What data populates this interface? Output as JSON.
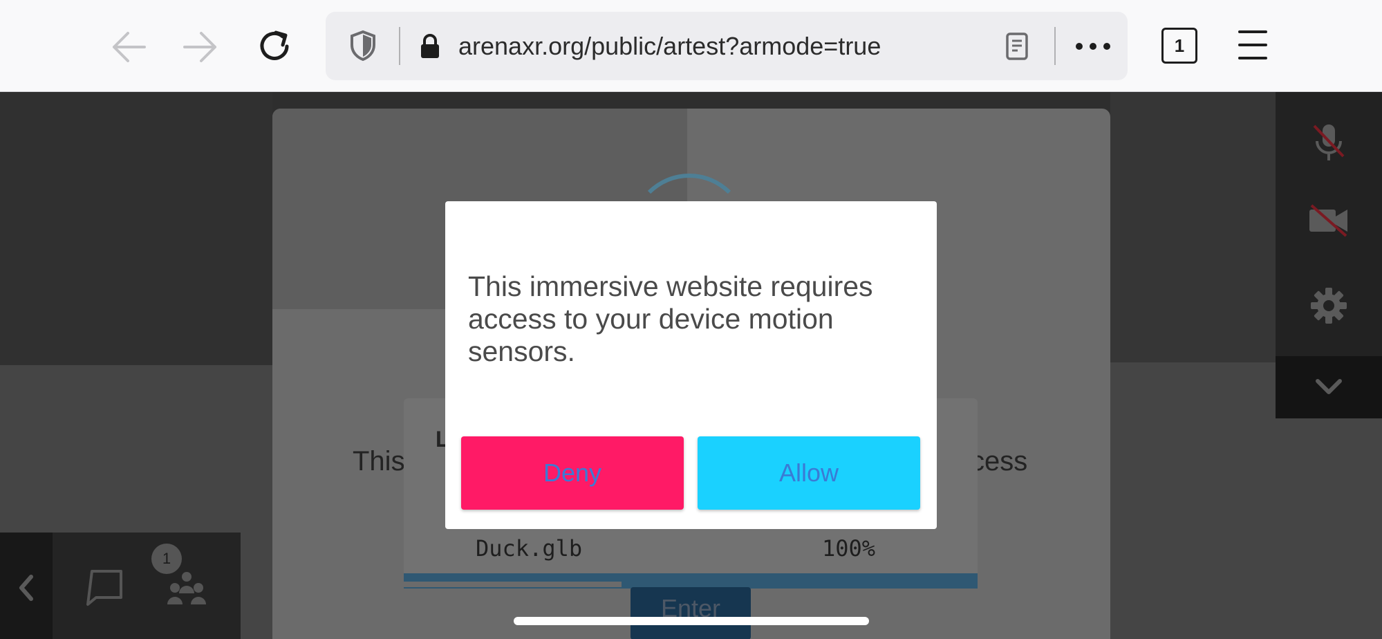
{
  "browser": {
    "url": "arenaxr.org/public/artest?armode=true",
    "tab_count": "1",
    "icons": [
      "back-arrow-icon",
      "forward-arrow-icon",
      "reload-icon",
      "shield-icon",
      "lock-icon",
      "reader-view-icon",
      "more-dots-icon",
      "tabs-icon",
      "hamburger-menu-icon"
    ]
  },
  "page": {
    "behind_text_left": "This",
    "behind_text_right": "cess",
    "loading_heading_fragment": "L",
    "loading_file": "Duck.glb",
    "loading_percent": "100%",
    "loading_progress": 0.38,
    "enter_label": "Enter",
    "user_count": "1",
    "right_panel_icons": [
      "mic-off-icon",
      "video-off-icon",
      "gear-icon",
      "chevron-down-icon"
    ],
    "bottom_panel_icons": [
      "chevron-left-icon",
      "chat-icon",
      "users-icon"
    ]
  },
  "dialog": {
    "message": "This immersive website requires access to your device motion sensors.",
    "deny_label": "Deny",
    "allow_label": "Allow"
  },
  "colors": {
    "deny": "#ff1a66",
    "allow": "#1ad1ff",
    "button_text": "#3a7bd5"
  }
}
